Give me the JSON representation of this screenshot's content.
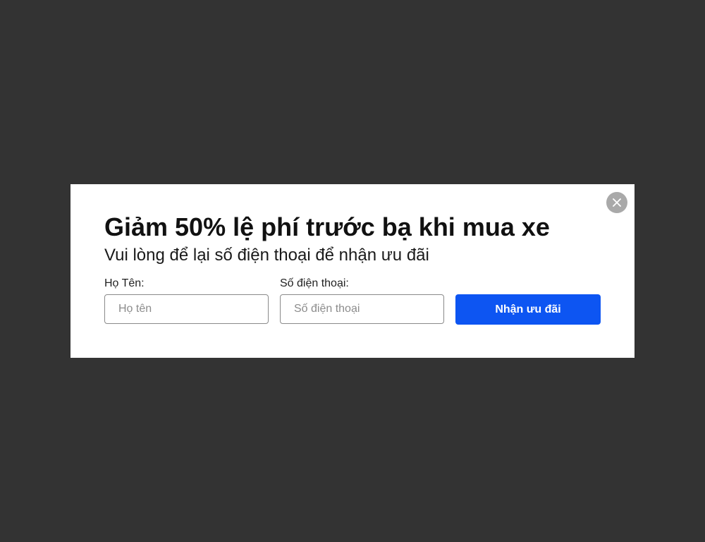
{
  "modal": {
    "title": "Giảm 50% lệ phí trước bạ khi mua xe",
    "subtitle": "Vui lòng để lại số điện thoại để nhận ưu đãi",
    "close_icon": "close-icon",
    "form": {
      "name_label": "Họ Tên:",
      "name_placeholder": "Họ tên",
      "name_value": "",
      "phone_label": "Số điện thoại:",
      "phone_placeholder": "Số điện thoại",
      "phone_value": "",
      "submit_label": "Nhận ưu đãi"
    }
  },
  "colors": {
    "backdrop": "#333333",
    "modal_bg": "#ffffff",
    "accent": "#0d55f2",
    "close_button_bg": "#a9a9a9"
  }
}
